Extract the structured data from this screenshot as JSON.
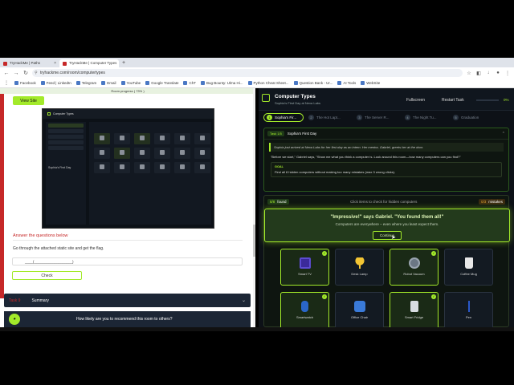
{
  "browser": {
    "tabs": [
      {
        "title": "TryHackMe | Paths",
        "active": false
      },
      {
        "title": "TryHackMe | Computer Types",
        "active": true
      }
    ],
    "new_tab": "+",
    "url": "tryhackme.com/room/computertypes",
    "bookmarks": [
      "Facebook",
      "Feed | LinkedIn",
      "Telegram",
      "Email",
      "YouTube",
      "Google Translate",
      "ChT",
      "Bug Bounty: Ulma Hi...",
      "Python Cheat Sheet...",
      "Question Bank - Ur...",
      "AI Tools",
      "WebSite"
    ]
  },
  "left": {
    "room_progress": "Room progress ( 73% )",
    "view_site": "View Site",
    "preview": {
      "title": "Computer Types",
      "subtitle": "Sophia's First Day"
    },
    "answer_heading": "Answer the questions below",
    "question": "Go through the attached static site and get the flag.",
    "answer_value": "____{___________________}",
    "check": "Check",
    "next_task": {
      "number": "Task 9",
      "title": "Summary"
    },
    "feedback": "How likely are you to recommend this room to others?"
  },
  "right": {
    "title": "Computer Types",
    "subtitle": "Sophia's First Day at Nexa Labs",
    "fullscreen": "Fullscreen",
    "restart": "Restart Task",
    "progress": "0%",
    "progress_fraction": 0,
    "steps": [
      {
        "n": "1",
        "label": "Sophia's Fir...",
        "active": true
      },
      {
        "n": "2",
        "label": "The Hot Lapt...",
        "active": false
      },
      {
        "n": "3",
        "label": "The Server R...",
        "active": false
      },
      {
        "n": "4",
        "label": "The Night Tu...",
        "active": false
      },
      {
        "n": "5",
        "label": "Graduation",
        "active": false
      }
    ],
    "task": {
      "badge": "Task 1/5",
      "title": "Sophia's First Day",
      "story": "Sophia just arrived at Nexa Labs for her first day as an intern. Her mentor, Gabriel, greets her at the door.",
      "dialog": "\"Before we start,\" Gabriel says, \"Show me what you think a computer is. Look around this room—how many computers can you find?\"",
      "goal_label": "GOAL",
      "goal_text": "Find all 8 hidden computers without making too many mistakes (max 3 wrong clicks)."
    },
    "area": {
      "found_count": "8/8",
      "found_label": "found",
      "hint": "Click items to check for hidden computers",
      "mistakes_count": "0/3",
      "mistakes_label": "mistakes",
      "popup_title": "\"Impressive!\" says Gabriel. \"You found them all!\"",
      "popup_text": "Computers are everywhere – even where you least expect them.",
      "popup_button": "Continue",
      "items": [
        {
          "label": "Smart TV",
          "icon": "tv-icon",
          "found": true
        },
        {
          "label": "Desk Lamp",
          "icon": "lamp-icon",
          "found": false
        },
        {
          "label": "Robot Vacuum",
          "icon": "robot-vacuum-icon",
          "found": true
        },
        {
          "label": "Coffee Mug",
          "icon": "mug-icon",
          "found": false
        },
        {
          "label": "Smartwatch",
          "icon": "watch-icon",
          "found": true
        },
        {
          "label": "Office Chair",
          "icon": "chair-icon",
          "found": false
        },
        {
          "label": "Smart Fridge",
          "icon": "fridge-icon",
          "found": true
        },
        {
          "label": "Pen",
          "icon": "pen-icon",
          "found": false
        }
      ]
    }
  }
}
